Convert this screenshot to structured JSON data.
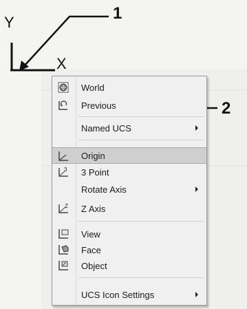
{
  "axis": {
    "y_label": "Y",
    "x_label": "X"
  },
  "callouts": [
    "1",
    "2"
  ],
  "menu": {
    "items": [
      {
        "label": "World",
        "icon": "ucs-world-icon",
        "submenu": false
      },
      {
        "label": "Previous",
        "icon": "ucs-previous-icon",
        "submenu": false
      },
      {
        "label": "Named UCS",
        "icon": "",
        "submenu": true
      },
      {
        "label": "Origin",
        "icon": "ucs-origin-icon",
        "submenu": false,
        "highlighted": true
      },
      {
        "label": "3 Point",
        "icon": "ucs-3point-icon",
        "submenu": false
      },
      {
        "label": "Rotate Axis",
        "icon": "",
        "submenu": true
      },
      {
        "label": "Z Axis",
        "icon": "ucs-zaxis-icon",
        "submenu": false
      },
      {
        "label": "View",
        "icon": "ucs-view-icon",
        "submenu": false
      },
      {
        "label": "Face",
        "icon": "ucs-face-icon",
        "submenu": false
      },
      {
        "label": "Object",
        "icon": "ucs-object-icon",
        "submenu": false
      },
      {
        "label": "UCS Icon Settings",
        "icon": "",
        "submenu": true
      }
    ]
  },
  "colors": {
    "highlight": "#cfcfcf",
    "menu_bg": "#f0f0f0"
  }
}
